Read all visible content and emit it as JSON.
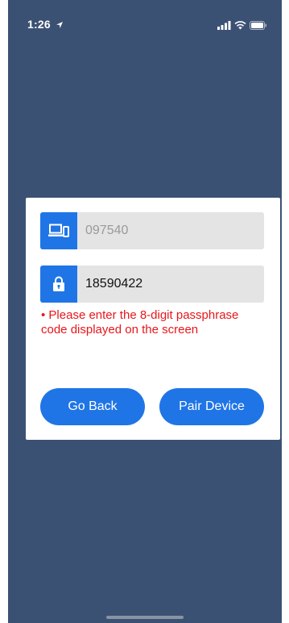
{
  "status_bar": {
    "time": "1:26",
    "location_icon": "location-arrow-icon",
    "signal_icon": "cellular-signal-icon",
    "wifi_icon": "wifi-icon",
    "battery_icon": "battery-icon"
  },
  "pairing": {
    "device_field": {
      "icon": "device-icon",
      "value": "097540"
    },
    "passphrase_field": {
      "icon": "lock-icon",
      "value": "18590422"
    },
    "error_message": "• Please enter the 8-digit passphrase code displayed on the screen",
    "back_button_label": "Go Back",
    "pair_button_label": "Pair Device"
  },
  "colors": {
    "background": "#3b5173",
    "accent": "#1f75e6",
    "error": "#e8161b"
  }
}
